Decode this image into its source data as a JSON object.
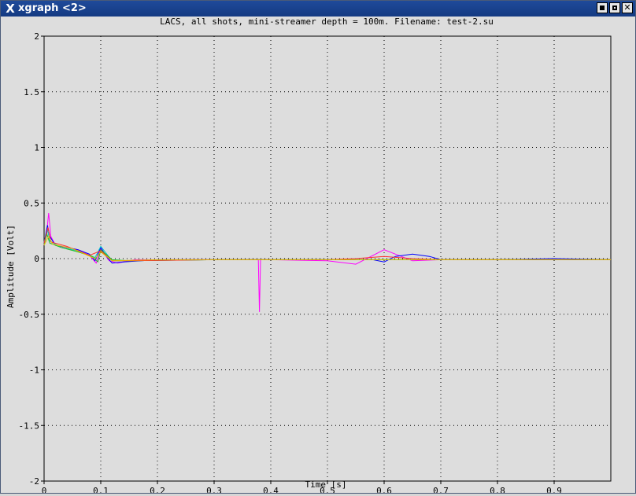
{
  "window": {
    "title": "xgraph <2>",
    "app_icon": "x-logo-icon",
    "buttons": [
      "minimize-icon",
      "maximize-icon",
      "close-icon"
    ],
    "close_glyph": "✕"
  },
  "chart_data": {
    "type": "line",
    "title": "LACS, all shots, mini-streamer depth = 100m. Filename: test-2.su",
    "xlabel": "Time [s]",
    "ylabel": "Amplitude [Volt]",
    "xlim": [
      0,
      1.0
    ],
    "ylim": [
      -2,
      2
    ],
    "xticks": [
      0,
      0.1,
      0.2,
      0.3,
      0.4,
      0.5,
      0.6,
      0.7,
      0.8,
      0.9
    ],
    "xtick_labels": [
      "0",
      "0.1",
      "0.2",
      "0.3",
      "0.4",
      "0.5",
      "0.6",
      "0.7",
      "0.8",
      "0.9"
    ],
    "yticks": [
      2,
      1.5,
      1,
      0.5,
      0,
      -0.5,
      -1,
      -1.5,
      -2
    ],
    "ytick_labels": [
      "2",
      "1.5",
      "1",
      "0.5",
      "0",
      "-0.5",
      "-1",
      "-1.5",
      "-2"
    ],
    "grid": true,
    "background": "#dddddd",
    "series": [
      {
        "color": "#ff00ff",
        "x": [
          0,
          0.005,
          0.008,
          0.012,
          0.02,
          0.04,
          0.06,
          0.08,
          0.092,
          0.1,
          0.105,
          0.115,
          0.13,
          0.16,
          0.2,
          0.3,
          0.378,
          0.38,
          0.382,
          0.4,
          0.5,
          0.55,
          0.6,
          0.62,
          0.65,
          0.7,
          0.8,
          0.9,
          1.0
        ],
        "y": [
          0.12,
          0.25,
          0.41,
          0.2,
          0.12,
          0.1,
          0.08,
          0.03,
          -0.04,
          0.09,
          0.05,
          -0.02,
          -0.04,
          -0.01,
          -0.01,
          -0.01,
          -0.01,
          -0.48,
          -0.01,
          -0.01,
          -0.02,
          -0.05,
          0.08,
          0.04,
          -0.02,
          -0.01,
          -0.01,
          -0.01,
          -0.01
        ]
      },
      {
        "color": "#0000ff",
        "x": [
          0,
          0.006,
          0.01,
          0.02,
          0.04,
          0.06,
          0.08,
          0.09,
          0.1,
          0.11,
          0.12,
          0.14,
          0.2,
          0.3,
          0.4,
          0.5,
          0.58,
          0.6,
          0.62,
          0.65,
          0.68,
          0.7,
          0.8,
          0.9,
          1.0
        ],
        "y": [
          0.14,
          0.3,
          0.2,
          0.12,
          0.1,
          0.08,
          0.04,
          -0.02,
          0.1,
          0.02,
          -0.04,
          -0.03,
          -0.01,
          -0.01,
          -0.01,
          -0.01,
          -0.01,
          -0.03,
          0.02,
          0.04,
          0.02,
          -0.01,
          -0.01,
          0.0,
          -0.01
        ]
      },
      {
        "color": "#00c8c8",
        "x": [
          0,
          0.006,
          0.01,
          0.03,
          0.06,
          0.09,
          0.1,
          0.12,
          0.15,
          0.3,
          0.5,
          0.7,
          0.9,
          1.0
        ],
        "y": [
          0.15,
          0.26,
          0.16,
          0.1,
          0.07,
          0.01,
          0.11,
          -0.02,
          -0.02,
          -0.01,
          -0.01,
          -0.01,
          -0.01,
          -0.01
        ]
      },
      {
        "color": "#20c020",
        "x": [
          0,
          0.005,
          0.01,
          0.03,
          0.06,
          0.085,
          0.095,
          0.1,
          0.12,
          0.15,
          0.3,
          0.5,
          0.7,
          0.9,
          1.0
        ],
        "y": [
          0.13,
          0.22,
          0.14,
          0.1,
          0.06,
          0.02,
          -0.03,
          0.08,
          -0.01,
          -0.02,
          -0.01,
          -0.01,
          -0.01,
          -0.01,
          -0.01
        ]
      },
      {
        "color": "#ff3030",
        "x": [
          0,
          0.007,
          0.012,
          0.04,
          0.08,
          0.1,
          0.12,
          0.15,
          0.3,
          0.5,
          0.55,
          0.6,
          0.65,
          0.7,
          0.9,
          1.0
        ],
        "y": [
          0.14,
          0.28,
          0.15,
          0.11,
          0.03,
          0.07,
          -0.02,
          -0.02,
          -0.01,
          -0.01,
          0.0,
          0.02,
          0.0,
          -0.01,
          -0.01,
          -0.01
        ]
      },
      {
        "color": "#e0c000",
        "x": [
          0,
          0.008,
          0.015,
          0.05,
          0.09,
          0.1,
          0.12,
          0.2,
          0.5,
          0.8,
          1.0
        ],
        "y": [
          0.12,
          0.2,
          0.13,
          0.09,
          0.0,
          0.06,
          -0.02,
          -0.01,
          -0.01,
          -0.01,
          -0.01
        ]
      }
    ]
  }
}
